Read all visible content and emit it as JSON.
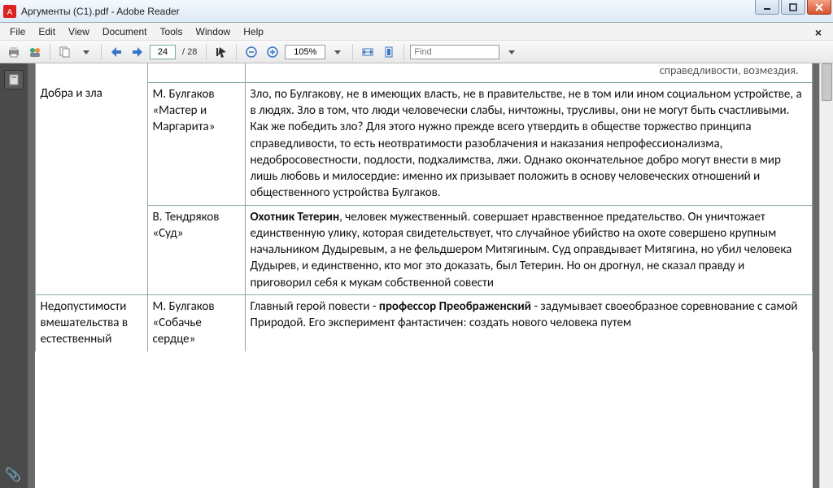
{
  "window": {
    "title": "Аргументы (C1).pdf - Adobe Reader"
  },
  "menu": {
    "file": "File",
    "edit": "Edit",
    "view": "View",
    "document": "Document",
    "tools": "Tools",
    "window": "Window",
    "help": "Help"
  },
  "toolbar": {
    "page_current": "24",
    "page_total": "/ 28",
    "zoom": "105%",
    "find_placeholder": "Find"
  },
  "doc": {
    "truncated_top": "справедливости, возмездия.",
    "rows": [
      {
        "theme": "Добра и зла",
        "source": "М. Булгаков «Мастер и Маргарита»",
        "text": "Зло, по Булгакову, не в имеющих власть, не в правительстве, не в том или ином социальном устройстве, а в людях. Зло в том, что люди человечески слабы, ничтожны, трусливы, они не могут быть счастливыми. Как же победить зло? Для этого нужно прежде всего утвердить в обществе торжество принципа справедливости, то есть неотвратимости разоблачения и наказания непрофессионализма, недобросовестности, подлости, подхалимства, лжи. Однако окончательное добро могут внести в мир лишь любовь и милосердие: именно их призывает положить в основу человеческих отношений и общественного устройства Булгаков."
      },
      {
        "theme": "",
        "source": "В. Тендряков «Суд»",
        "text_prefix": "Охотник Тетерин",
        "text_rest": ", человек мужественный. совершает нравственное предательство. Он уничтожает единственную улику, которая свидетельствует, что случайное убийство на охоте совершено крупным начальником Дудыревым, а не фельдшером Митягиным. Суд оправдывает Митягина, но убил человека Дудырев, и единственно, кто мог это доказать, был Тетерин. Но он дрогнул, не сказал правду и приговорил себя к мукам собственной совести"
      },
      {
        "theme": "Недопустимости вмешательства в естественный",
        "source": "М. Булгаков «Собачье сердце»",
        "text_prefix2": "профессор Преображенский",
        "text_pre": "Главный герой повести - ",
        "text_post": " - задумывает своеобразное соревнование с самой Природой. Его эксперимент фантастичен: создать нового человека путем"
      }
    ]
  }
}
